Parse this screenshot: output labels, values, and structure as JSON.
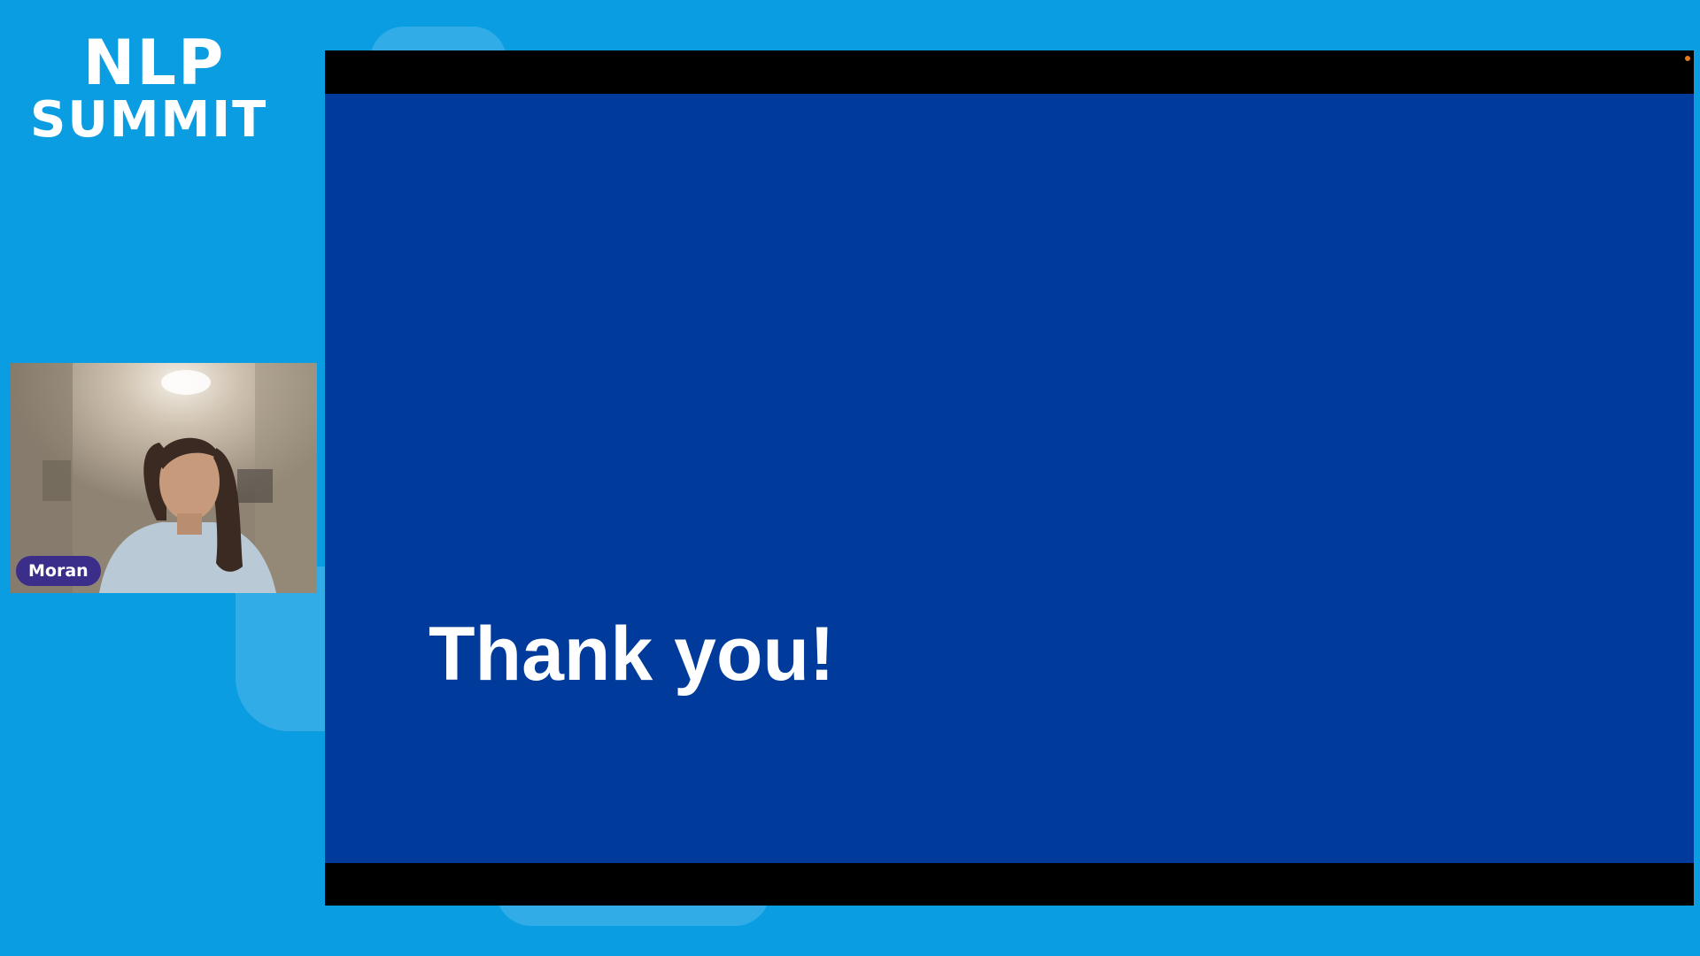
{
  "logo": {
    "line1": "NLP",
    "line2": "SUMMIT"
  },
  "speaker": {
    "name": "Moran"
  },
  "slide": {
    "title": "Thank you!"
  },
  "colors": {
    "background": "#0a9de2",
    "slide_background": "#003a9a",
    "letterbox": "#000000",
    "name_badge": "#3b2d8a",
    "text": "#ffffff"
  }
}
